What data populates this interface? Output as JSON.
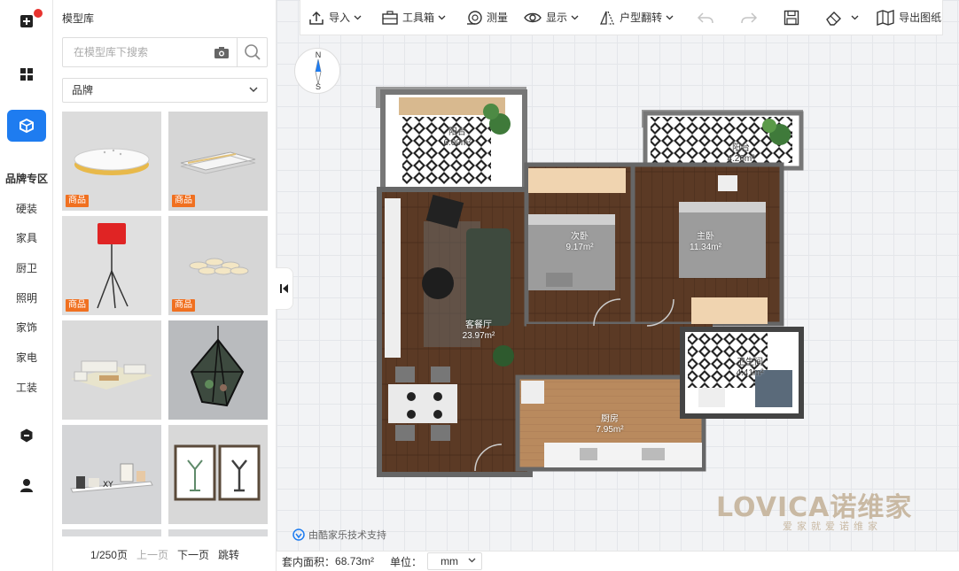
{
  "panel": {
    "title": "模型库",
    "search_placeholder": "在模型库下搜索",
    "brand_filter": "品牌",
    "cards": [
      {
        "tag": "商品"
      },
      {
        "tag": "商品"
      },
      {
        "tag": "商品"
      },
      {
        "tag": "商品"
      },
      {
        "tag": ""
      },
      {
        "tag": ""
      },
      {
        "tag": ""
      },
      {
        "tag": ""
      }
    ]
  },
  "rail": {
    "categories": [
      "品牌专区",
      "硬装",
      "家具",
      "厨卫",
      "照明",
      "家饰",
      "家电",
      "工装"
    ]
  },
  "pager": {
    "page_info": "1/250页",
    "prev": "上一页",
    "next": "下一页",
    "jump": "跳转"
  },
  "toolbar": {
    "import": "导入",
    "toolbox": "工具箱",
    "measure": "测量",
    "display": "显示",
    "flip": "户型翻转",
    "export": "导出图纸"
  },
  "compass": {
    "north": "N",
    "south": "S"
  },
  "rooms": {
    "balcony1": {
      "name": "阳台",
      "area": "6.00m²"
    },
    "balcony2": {
      "name": "阳台",
      "area": "4.26m²"
    },
    "bedroom2": {
      "name": "次卧",
      "area": "9.17m²"
    },
    "master": {
      "name": "主卧",
      "area": "11.34m²"
    },
    "living": {
      "name": "客餐厅",
      "area": "23.97m²"
    },
    "bathroom": {
      "name": "卫生间",
      "area": "4.41m²"
    },
    "kitchen": {
      "name": "厨房",
      "area": "7.95m²"
    }
  },
  "support_text": "由酷家乐技术支持",
  "logo": {
    "main": "LOVICA诺维家",
    "sub": "爱家就爱诺维家"
  },
  "status": {
    "area_label": "套内面积：",
    "area_value": "68.73m²",
    "unit_label": "单位：",
    "unit_value": "mm"
  },
  "colors": {
    "accent": "#1e7cf0",
    "tag": "#f07020",
    "floor": "#5a3a26",
    "wall": "#555555"
  }
}
